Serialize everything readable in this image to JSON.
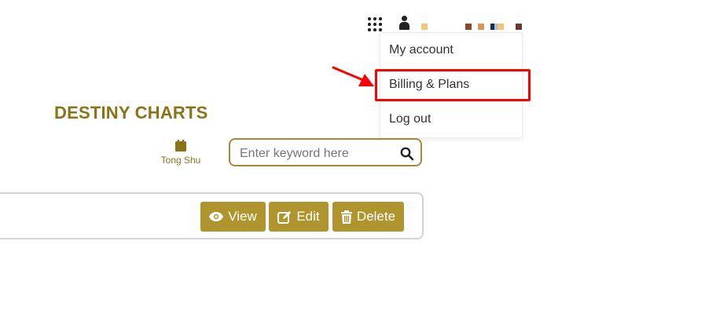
{
  "header": {
    "apps_icon": "apps-grid-icon",
    "user_icon": "user-icon",
    "swatches": [
      "#f9c27a",
      "#8b4a2b",
      "#d9965a",
      "#1e2a4a",
      "#9fc3de",
      "#f9c27a",
      "#6b3a2a"
    ]
  },
  "account_menu": {
    "items": [
      {
        "label": "My account"
      },
      {
        "label": "Billing & Plans"
      },
      {
        "label": "Log out"
      }
    ],
    "highlight_color": "#ff0000"
  },
  "page": {
    "title": "DESTINY CHARTS",
    "tong_shu_label": "Tong Shu"
  },
  "search": {
    "placeholder": "Enter keyword here",
    "value": ""
  },
  "actions": {
    "view_label": "View",
    "edit_label": "Edit",
    "delete_label": "Delete",
    "accent": "#b0952f"
  }
}
